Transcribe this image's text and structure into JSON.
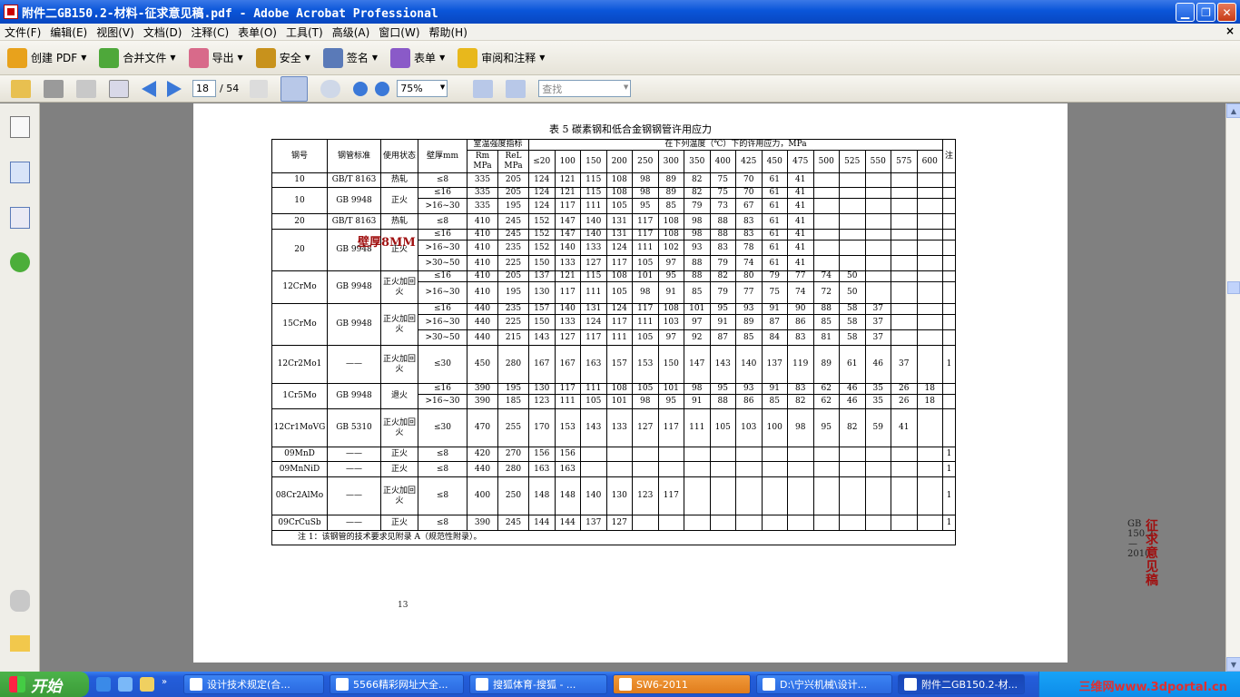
{
  "window": {
    "title": "附件二GB150.2-材料-征求意见稿.pdf - Adobe Acrobat Professional",
    "min": "▁",
    "max": "❐",
    "close": "✕"
  },
  "menu": [
    "文件(F)",
    "编辑(E)",
    "视图(V)",
    "文档(D)",
    "注释(C)",
    "表单(O)",
    "工具(T)",
    "高级(A)",
    "窗口(W)",
    "帮助(H)"
  ],
  "menu_close": "×",
  "toolbar1": [
    {
      "label": "创建 PDF",
      "icon": "create-pdf-icon",
      "color": "#e8a21c"
    },
    {
      "label": "合并文件",
      "icon": "combine-files-icon",
      "color": "#4ea83a"
    },
    {
      "label": "导出",
      "icon": "export-icon",
      "color": "#d86a8a"
    },
    {
      "label": "安全",
      "icon": "lock-icon",
      "color": "#c8921c"
    },
    {
      "label": "签名",
      "icon": "pen-icon",
      "color": "#5a7ab8"
    },
    {
      "label": "表单",
      "icon": "form-icon",
      "color": "#8a5ac8"
    },
    {
      "label": "审阅和注释",
      "icon": "comment-icon",
      "color": "#e8b81c"
    }
  ],
  "toolbar2": {
    "page_current": "18",
    "page_total": "/ 54",
    "zoom": "75%",
    "find_placeholder": "查找"
  },
  "document": {
    "table_title": "表 5   碳素钢和低合金钢钢管许用应力",
    "header": {
      "steel": "钢号",
      "standard": "钢管标准",
      "state": "使用状态",
      "thickness": "壁厚mm",
      "room_temp": "室温强度指标",
      "rm": "Rm MPa",
      "rel": "ReL MPa",
      "stress_header": "在下列温度（℃）下的许用应力，MPa",
      "note": "注",
      "temps": [
        "≤20",
        "100",
        "150",
        "200",
        "250",
        "300",
        "350",
        "400",
        "425",
        "450",
        "475",
        "500",
        "525",
        "550",
        "575",
        "600"
      ]
    },
    "rows": [
      {
        "steel": "10",
        "std": "GB/T 8163",
        "state": "热轧",
        "thick": "≤8",
        "rm": "335",
        "rel": "205",
        "vals": [
          "124",
          "121",
          "115",
          "108",
          "98",
          "89",
          "82",
          "75",
          "70",
          "61",
          "41",
          "",
          "",
          "",
          "",
          ""
        ],
        "note": ""
      },
      {
        "steel": "10",
        "std": "GB 9948",
        "state": "正火",
        "thick": "≤16",
        "rm": "335",
        "rel": "205",
        "vals": [
          "124",
          "121",
          "115",
          "108",
          "98",
          "89",
          "82",
          "75",
          "70",
          "61",
          "41",
          "",
          "",
          "",
          "",
          ""
        ],
        "note": ""
      },
      {
        "steel": "",
        "std": "",
        "state": "",
        "thick": ">16~30",
        "rm": "335",
        "rel": "195",
        "vals": [
          "124",
          "117",
          "111",
          "105",
          "95",
          "85",
          "79",
          "73",
          "67",
          "61",
          "41",
          "",
          "",
          "",
          "",
          ""
        ],
        "note": ""
      },
      {
        "steel": "20",
        "std": "GB/T 8163",
        "state": "热轧",
        "thick": "≤8",
        "rm": "410",
        "rel": "245",
        "vals": [
          "152",
          "147",
          "140",
          "131",
          "117",
          "108",
          "98",
          "88",
          "83",
          "61",
          "41",
          "",
          "",
          "",
          "",
          ""
        ],
        "note": ""
      },
      {
        "steel": "20",
        "std": "GB 9948",
        "state": "正火",
        "thick": "≤16",
        "rm": "410",
        "rel": "245",
        "vals": [
          "152",
          "147",
          "140",
          "131",
          "117",
          "108",
          "98",
          "88",
          "83",
          "61",
          "41",
          "",
          "",
          "",
          "",
          ""
        ],
        "note": ""
      },
      {
        "steel": "",
        "std": "",
        "state": "",
        "thick": ">16~30",
        "rm": "410",
        "rel": "235",
        "vals": [
          "152",
          "140",
          "133",
          "124",
          "111",
          "102",
          "93",
          "83",
          "78",
          "61",
          "41",
          "",
          "",
          "",
          "",
          ""
        ],
        "note": ""
      },
      {
        "steel": "",
        "std": "",
        "state": "",
        "thick": ">30~50",
        "rm": "410",
        "rel": "225",
        "vals": [
          "150",
          "133",
          "127",
          "117",
          "105",
          "97",
          "88",
          "79",
          "74",
          "61",
          "41",
          "",
          "",
          "",
          "",
          ""
        ],
        "note": ""
      },
      {
        "steel": "12CrMo",
        "std": "GB 9948",
        "state": "正火加回火",
        "thick": "≤16",
        "rm": "410",
        "rel": "205",
        "vals": [
          "137",
          "121",
          "115",
          "108",
          "101",
          "95",
          "88",
          "82",
          "80",
          "79",
          "77",
          "74",
          "50",
          "",
          "",
          ""
        ],
        "note": ""
      },
      {
        "steel": "",
        "std": "",
        "state": "",
        "thick": ">16~30",
        "rm": "410",
        "rel": "195",
        "vals": [
          "130",
          "117",
          "111",
          "105",
          "98",
          "91",
          "85",
          "79",
          "77",
          "75",
          "74",
          "72",
          "50",
          "",
          "",
          ""
        ],
        "note": ""
      },
      {
        "steel": "15CrMo",
        "std": "GB 9948",
        "state": "正火加回火",
        "thick": "≤16",
        "rm": "440",
        "rel": "235",
        "vals": [
          "157",
          "140",
          "131",
          "124",
          "117",
          "108",
          "101",
          "95",
          "93",
          "91",
          "90",
          "88",
          "58",
          "37",
          "",
          ""
        ],
        "note": ""
      },
      {
        "steel": "",
        "std": "",
        "state": "",
        "thick": ">16~30",
        "rm": "440",
        "rel": "225",
        "vals": [
          "150",
          "133",
          "124",
          "117",
          "111",
          "103",
          "97",
          "91",
          "89",
          "87",
          "86",
          "85",
          "58",
          "37",
          "",
          ""
        ],
        "note": ""
      },
      {
        "steel": "",
        "std": "",
        "state": "",
        "thick": ">30~50",
        "rm": "440",
        "rel": "215",
        "vals": [
          "143",
          "127",
          "117",
          "111",
          "105",
          "97",
          "92",
          "87",
          "85",
          "84",
          "83",
          "81",
          "58",
          "37",
          "",
          ""
        ],
        "note": ""
      },
      {
        "steel": "12Cr2Mo1",
        "std": "——",
        "state": "正火加回火",
        "thick": "≤30",
        "rm": "450",
        "rel": "280",
        "vals": [
          "167",
          "167",
          "163",
          "157",
          "153",
          "150",
          "147",
          "143",
          "140",
          "137",
          "119",
          "89",
          "61",
          "46",
          "37",
          ""
        ],
        "note": "1"
      },
      {
        "steel": "1Cr5Mo",
        "std": "GB 9948",
        "state": "退火",
        "thick": "≤16",
        "rm": "390",
        "rel": "195",
        "vals": [
          "130",
          "117",
          "111",
          "108",
          "105",
          "101",
          "98",
          "95",
          "93",
          "91",
          "83",
          "62",
          "46",
          "35",
          "26",
          "18"
        ],
        "note": ""
      },
      {
        "steel": "",
        "std": "",
        "state": "",
        "thick": ">16~30",
        "rm": "390",
        "rel": "185",
        "vals": [
          "123",
          "111",
          "105",
          "101",
          "98",
          "95",
          "91",
          "88",
          "86",
          "85",
          "82",
          "62",
          "46",
          "35",
          "26",
          "18"
        ],
        "note": ""
      },
      {
        "steel": "12Cr1MoVG",
        "std": "GB 5310",
        "state": "正火加回火",
        "thick": "≤30",
        "rm": "470",
        "rel": "255",
        "vals": [
          "170",
          "153",
          "143",
          "133",
          "127",
          "117",
          "111",
          "105",
          "103",
          "100",
          "98",
          "95",
          "82",
          "59",
          "41",
          ""
        ],
        "note": ""
      },
      {
        "steel": "09MnD",
        "std": "——",
        "state": "正火",
        "thick": "≤8",
        "rm": "420",
        "rel": "270",
        "vals": [
          "156",
          "156",
          "",
          "",
          "",
          "",
          "",
          "",
          "",
          "",
          "",
          "",
          "",
          "",
          "",
          ""
        ],
        "note": "1"
      },
      {
        "steel": "09MnNiD",
        "std": "——",
        "state": "正火",
        "thick": "≤8",
        "rm": "440",
        "rel": "280",
        "vals": [
          "163",
          "163",
          "",
          "",
          "",
          "",
          "",
          "",
          "",
          "",
          "",
          "",
          "",
          "",
          "",
          ""
        ],
        "note": "1"
      },
      {
        "steel": "08Cr2AlMo",
        "std": "——",
        "state": "正火加回火",
        "thick": "≤8",
        "rm": "400",
        "rel": "250",
        "vals": [
          "148",
          "148",
          "140",
          "130",
          "123",
          "117",
          "",
          "",
          "",
          "",
          "",
          "",
          "",
          "",
          "",
          ""
        ],
        "note": "1"
      },
      {
        "steel": "09CrCuSb",
        "std": "——",
        "state": "正火",
        "thick": "≤8",
        "rm": "390",
        "rel": "245",
        "vals": [
          "144",
          "144",
          "137",
          "127",
          "",
          "",
          "",
          "",
          "",
          "",
          "",
          "",
          "",
          "",
          "",
          ""
        ],
        "note": "1"
      }
    ],
    "footnote": "注 1：该钢管的技术要求见附录 A（规范性附录）。",
    "annotation_thickness": "壁厚8MM",
    "annotation_draft": "征求意见稿",
    "standard_number": "GB 150.2—2010",
    "page_number": "13"
  },
  "taskbar": {
    "start": "开始",
    "tasks": [
      "设计技术规定(合...",
      "5566精彩网址大全...",
      "搜狐体育-搜狐 - ...",
      "SW6-2011",
      "D:\\宁兴机械\\设计...",
      "附件二GB150.2-材..."
    ],
    "watermark": "三维网www.3dportal.cn"
  }
}
